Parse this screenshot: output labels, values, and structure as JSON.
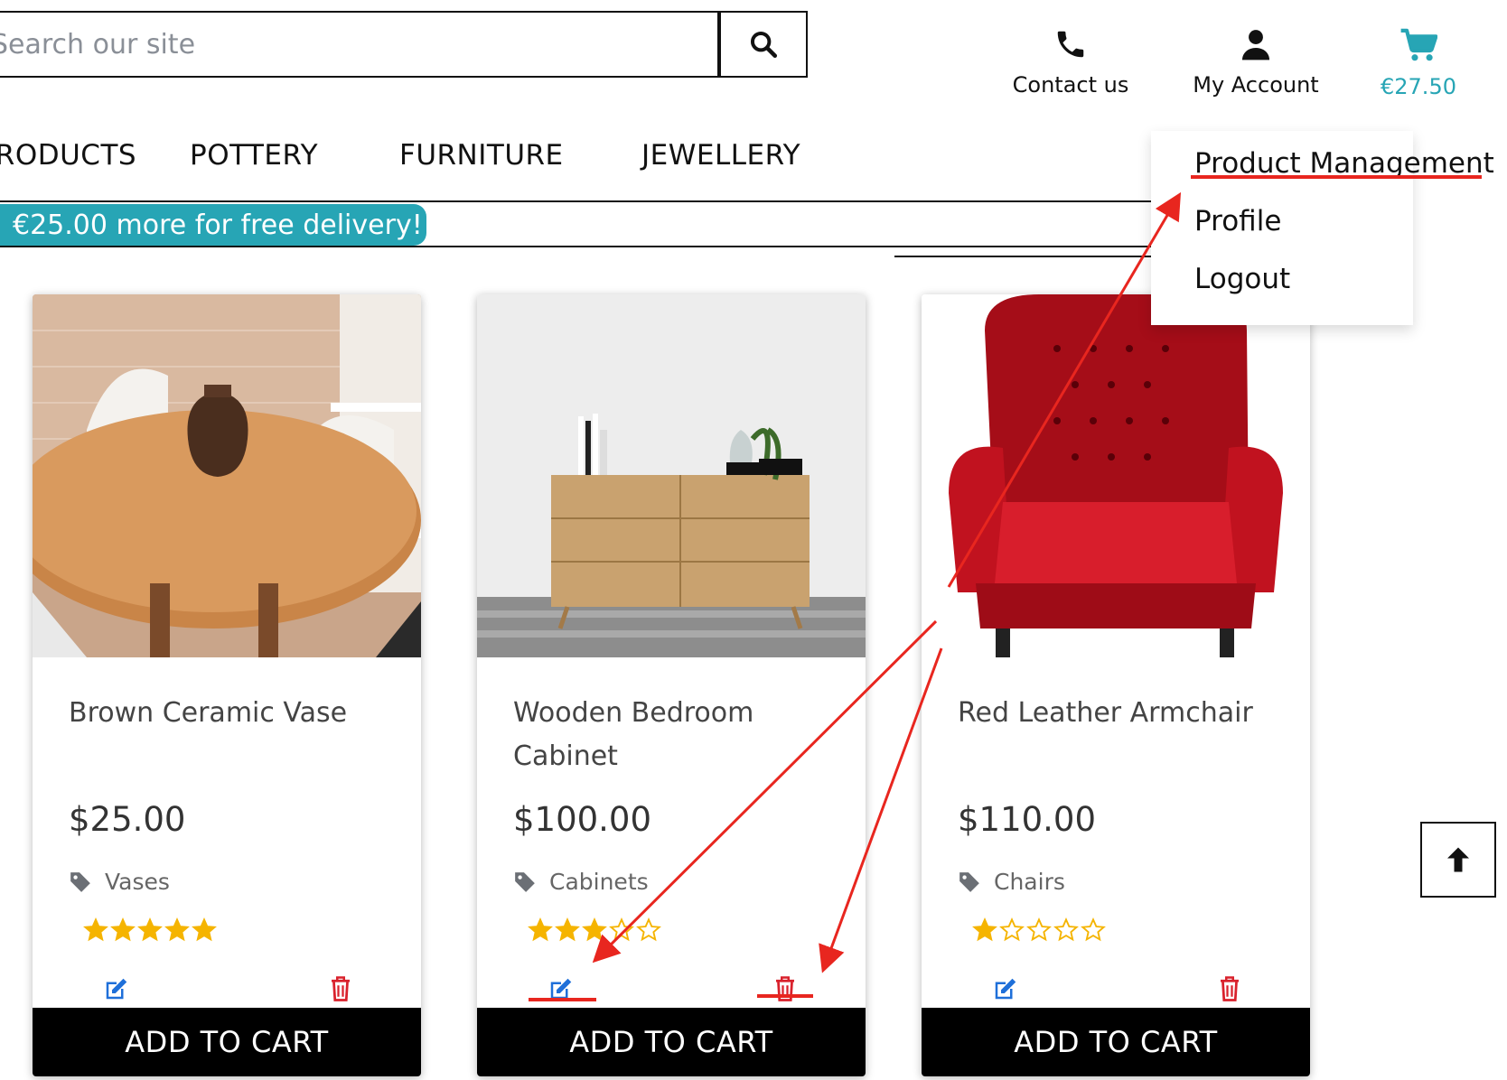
{
  "search": {
    "placeholder": "Search our site",
    "icon": "search-icon"
  },
  "header": {
    "contact_label": "Contact us",
    "account_label": "My Account",
    "cart_total": "€27.50",
    "accent_color": "#27a5b5"
  },
  "nav": {
    "items": [
      "ALL PRODUCTS",
      "POTTERY",
      "FURNITURE",
      "JEWELLERY"
    ]
  },
  "promo": {
    "text": "€25.00 more for free delivery!"
  },
  "account_menu": {
    "items": [
      "Product Management",
      "Profile",
      "Logout"
    ]
  },
  "products": [
    {
      "title": "Brown Ceramic Vase",
      "price": "$25.00",
      "category": "Vases",
      "rating": 5,
      "add_label": "ADD TO CART"
    },
    {
      "title": "Wooden Bedroom Cabinet",
      "price": "$100.00",
      "category": "Cabinets",
      "rating": 3,
      "add_label": "ADD TO CART"
    },
    {
      "title": "Red Leather Armchair",
      "price": "$110.00",
      "category": "Chairs",
      "rating": 1,
      "add_label": "ADD TO CART"
    }
  ],
  "colors": {
    "edit": "#1e6fd9",
    "delete": "#d9212c",
    "star": "#f5b400",
    "annotation": "#e8261f"
  }
}
